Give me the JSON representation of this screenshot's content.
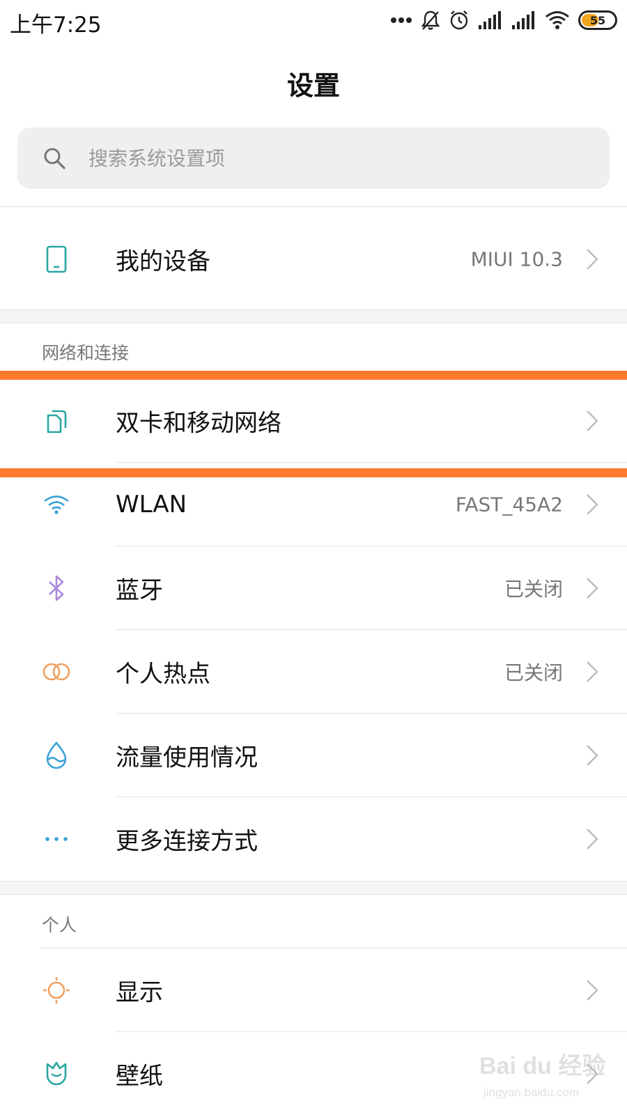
{
  "status_bar": {
    "time": "上午7:25",
    "battery_percent": 55,
    "battery_label": "55",
    "icons": [
      "more-dots-icon",
      "mute-bell-icon",
      "alarm-icon",
      "signal-sim1-icon",
      "signal-sim2-icon",
      "wifi-icon",
      "battery-icon"
    ]
  },
  "header": {
    "title": "设置"
  },
  "search": {
    "placeholder": "搜索系统设置项"
  },
  "my_device": {
    "label": "我的设备",
    "value": "MIUI 10.3",
    "icon": "phone-icon"
  },
  "network_section": {
    "header": "网络和连接",
    "items": [
      {
        "label": "双卡和移动网络",
        "value": "",
        "icon": "dual-sim-icon",
        "highlighted": true
      },
      {
        "label": "WLAN",
        "value": "FAST_45A2",
        "icon": "wifi-icon"
      },
      {
        "label": "蓝牙",
        "value": "已关闭",
        "icon": "bluetooth-icon"
      },
      {
        "label": "个人热点",
        "value": "已关闭",
        "icon": "hotspot-icon"
      },
      {
        "label": "流量使用情况",
        "value": "",
        "icon": "data-usage-icon"
      },
      {
        "label": "更多连接方式",
        "value": "",
        "icon": "more-connections-icon"
      }
    ]
  },
  "personal_section": {
    "header": "个人",
    "items": [
      {
        "label": "显示",
        "value": "",
        "icon": "display-sun-icon"
      },
      {
        "label": "壁纸",
        "value": "",
        "icon": "wallpaper-tulip-icon"
      }
    ]
  },
  "colors": {
    "highlight": "#ff7a2c",
    "bluetooth_icon": "#a98bd8",
    "hotspot_icon": "#f0a060",
    "teal_icon": "#2aa6a0",
    "blue_icon": "#3da3d6"
  },
  "watermark": {
    "main": "Bai du 经验",
    "sub": "jingyan.baidu.com"
  }
}
